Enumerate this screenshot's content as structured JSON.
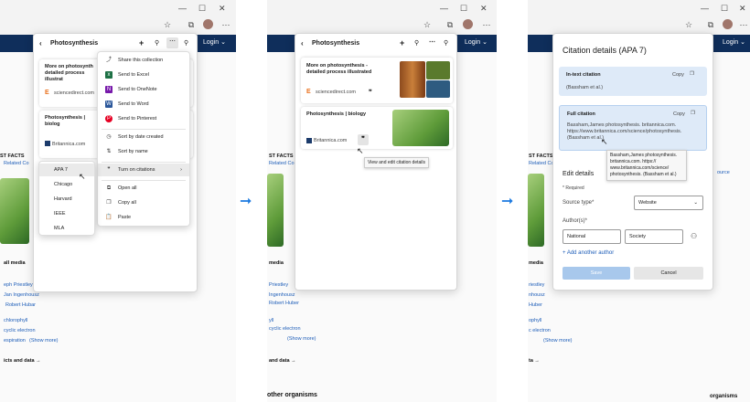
{
  "chrome": {
    "login_label": "Login"
  },
  "panel1": {
    "title": "Photosynthesis",
    "card1": {
      "title": "More on photosynth detailed process illustrat",
      "source": "sciencedirect.com"
    },
    "card2": {
      "title": "Photosynthesis | biolog",
      "source": "Britannica.com"
    },
    "menu": [
      {
        "icon": "share-icon",
        "label": "Share this collection"
      },
      {
        "icon": "excel-icon",
        "label": "Send to Excel"
      },
      {
        "icon": "onenote-icon",
        "label": "Send to OneNote"
      },
      {
        "icon": "word-icon",
        "label": "Send to Word"
      },
      {
        "icon": "pinterest-icon",
        "label": "Send to Pinterest"
      },
      {
        "icon": "clock-icon",
        "label": "Sort by date created"
      },
      {
        "icon": "sort-icon",
        "label": "Sort by name"
      },
      {
        "icon": "quote-icon",
        "label": "Turn on citations"
      },
      {
        "icon": "open-icon",
        "label": "Open all"
      },
      {
        "icon": "copy-icon",
        "label": "Copy all"
      },
      {
        "icon": "paste-icon",
        "label": "Paste"
      }
    ],
    "styles": [
      "APA 7",
      "Chicago",
      "Harvard",
      "IEEE",
      "MLA"
    ]
  },
  "panel2": {
    "title": "Photosynthesis",
    "card1": {
      "title": "More on photosynthesis - detailed process illustrated",
      "source": "sciencedirect.com"
    },
    "card2": {
      "title": "Photosynthesis | biology",
      "source": "Britannica.com"
    },
    "tooltip": "View and edit citation details"
  },
  "panel3": {
    "title": "Citation details (APA 7)",
    "intext": {
      "label": "In-text citation",
      "copy": "Copy",
      "value": "(Bassham et al.)"
    },
    "full": {
      "label": "Full citation",
      "copy": "Copy",
      "value": "Bassham,James photosynthesis. britannica.com. https://www.britannica.com/science/photosynthesis. (Bassham et al.)"
    },
    "tooltip": "Bassham,James photosynthesis. britannica.com. https:// www.britannica.com/science/ photosynthesis. (Bassham et al.)",
    "edit_title": "Edit details",
    "required": "* Required",
    "source_label": "Source type*",
    "source_value": "Website",
    "author_label": "Author(s)*",
    "author1": "National",
    "author2": "Society",
    "add_author": "+ Add another author",
    "save": "Save",
    "cancel": "Cancel",
    "peek": "ource"
  },
  "page_text": {
    "facts": "ST FACTS",
    "related": "Related Co",
    "all_media": "all media",
    "people": [
      "eph Priestley",
      "Jan Ingenhousz",
      "Robert Hubar"
    ],
    "chloro": "chlorophyll",
    "cyclic": "cyclic electron",
    "respir": "espiration",
    "show_more": "(Show more)",
    "facts_data": "icts and data",
    "other": "other organisms",
    "media2": "media",
    "ppl2": [
      "Priestley",
      "Ingenhousz",
      "Robert Huber"
    ],
    "chl2": "yll",
    "cyc2": "cyclic electron",
    "ppl3": [
      "riestley",
      "nhousz",
      "Huber"
    ],
    "chl3": "ophyll",
    "cyc3": "c electron",
    "facts2": "and data",
    "facts3": "ta",
    "orgs": "organisms"
  }
}
